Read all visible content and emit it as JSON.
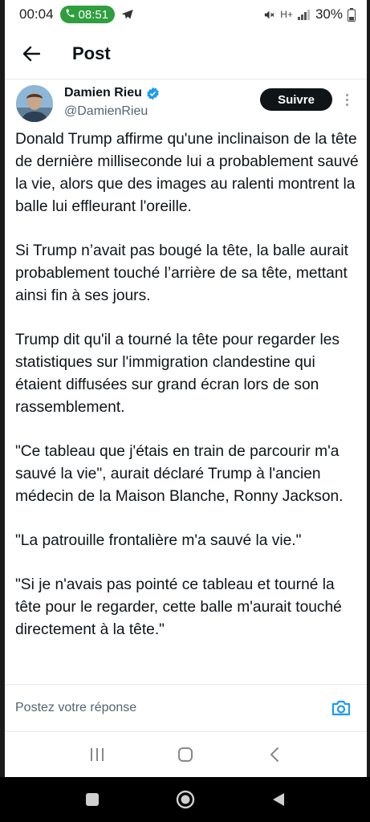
{
  "status_bar": {
    "time": "00:04",
    "call_time": "08:51",
    "network": "H+",
    "battery": "30%"
  },
  "header": {
    "title": "Post"
  },
  "author": {
    "name": "Damien Rieu",
    "handle": "@DamienRieu",
    "follow_label": "Suivre"
  },
  "tweet": {
    "paragraphs": [
      "Donald Trump affirme qu'une inclinaison de la tête de dernière milliseconde lui a probablement sauvé la vie, alors que des images au ralenti montrent la balle lui effleurant l'oreille.",
      "Si Trump n’avait pas bougé la tête, la balle aurait probablement touché l’arrière de sa tête, mettant ainsi fin à ses jours.",
      "Trump dit qu'il a tourné la tête pour regarder les statistiques sur l'immigration clandestine qui étaient diffusées sur grand écran lors de son rassemblement.",
      "\"Ce tableau que j'étais en train de parcourir m'a sauvé la vie\", aurait déclaré Trump à l'ancien médecin de la Maison Blanche, Ronny Jackson.",
      "\"La patrouille frontalière m'a sauvé la vie.\"",
      "\"Si je n'avais pas pointé ce tableau et tourné la tête pour le regarder, cette balle m'aurait touché directement à la tête.\""
    ]
  },
  "reply": {
    "placeholder": "Postez votre réponse"
  },
  "colors": {
    "call_green": "#2e9e3e",
    "verified_blue": "#1d9bf0",
    "follow_bg": "#0f1419",
    "muted_text": "#536471"
  },
  "icons": {
    "back": "arrow-left-icon",
    "verified": "verified-badge-icon",
    "more": "more-vertical-icon",
    "camera": "camera-icon",
    "call": "phone-icon",
    "telegram": "telegram-icon",
    "mute": "mute-icon",
    "signal": "signal-icon",
    "battery": "battery-icon"
  }
}
